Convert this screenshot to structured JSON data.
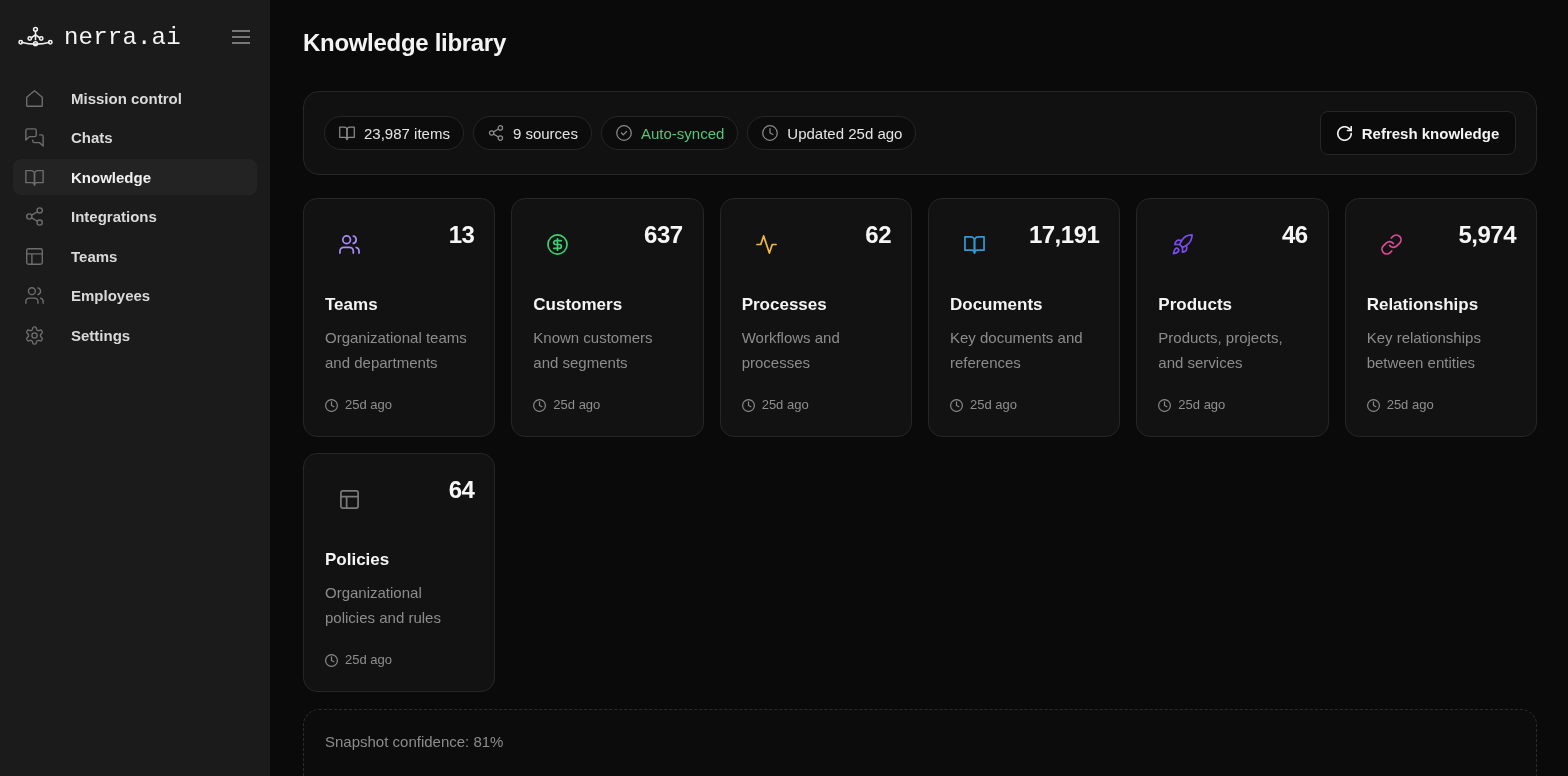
{
  "sidebar": {
    "logo": "nerra.ai",
    "items": [
      {
        "label": "Mission control",
        "selected": false
      },
      {
        "label": "Chats",
        "selected": false
      },
      {
        "label": "Knowledge",
        "selected": true
      },
      {
        "label": "Integrations",
        "selected": false
      },
      {
        "label": "Teams",
        "selected": false
      },
      {
        "label": "Employees",
        "selected": false
      },
      {
        "label": "Settings",
        "selected": false
      }
    ]
  },
  "header": {
    "title": "Knowledge library"
  },
  "stats": {
    "chips": [
      {
        "label": "23,987 items",
        "color": "#e4e4e4"
      },
      {
        "label": "9 sources",
        "color": "#e4e4e4"
      },
      {
        "label": "Auto-synced",
        "color": "#55c57a"
      },
      {
        "label": "Updated 25d ago",
        "color": "#e4e4e4"
      }
    ],
    "refresh_button": "Refresh knowledge"
  },
  "cards": [
    {
      "title": "Teams",
      "count": "13",
      "description": "Organizational teams and departments",
      "updated": "25d ago",
      "color": "#a78bfa"
    },
    {
      "title": "Customers",
      "count": "637",
      "description": "Known customers and segments",
      "updated": "25d ago",
      "color": "#3ecf72"
    },
    {
      "title": "Processes",
      "count": "62",
      "description": "Workflows and processes",
      "updated": "25d ago",
      "color": "#f2b94a"
    },
    {
      "title": "Documents",
      "count": "17,191",
      "description": "Key documents and references",
      "updated": "25d ago",
      "color": "#2d9ad8"
    },
    {
      "title": "Products",
      "count": "46",
      "description": "Products, projects, and services",
      "updated": "25d ago",
      "color": "#7a4cf0"
    },
    {
      "title": "Relationships",
      "count": "5,974",
      "description": "Key relationships between entities",
      "updated": "25d ago",
      "color": "#e0489a"
    },
    {
      "title": "Policies",
      "count": "64",
      "description": "Organizational policies and rules",
      "updated": "25d ago",
      "color": "#7a7a7a"
    }
  ],
  "footer": {
    "confidence": "Snapshot confidence: 81%"
  }
}
